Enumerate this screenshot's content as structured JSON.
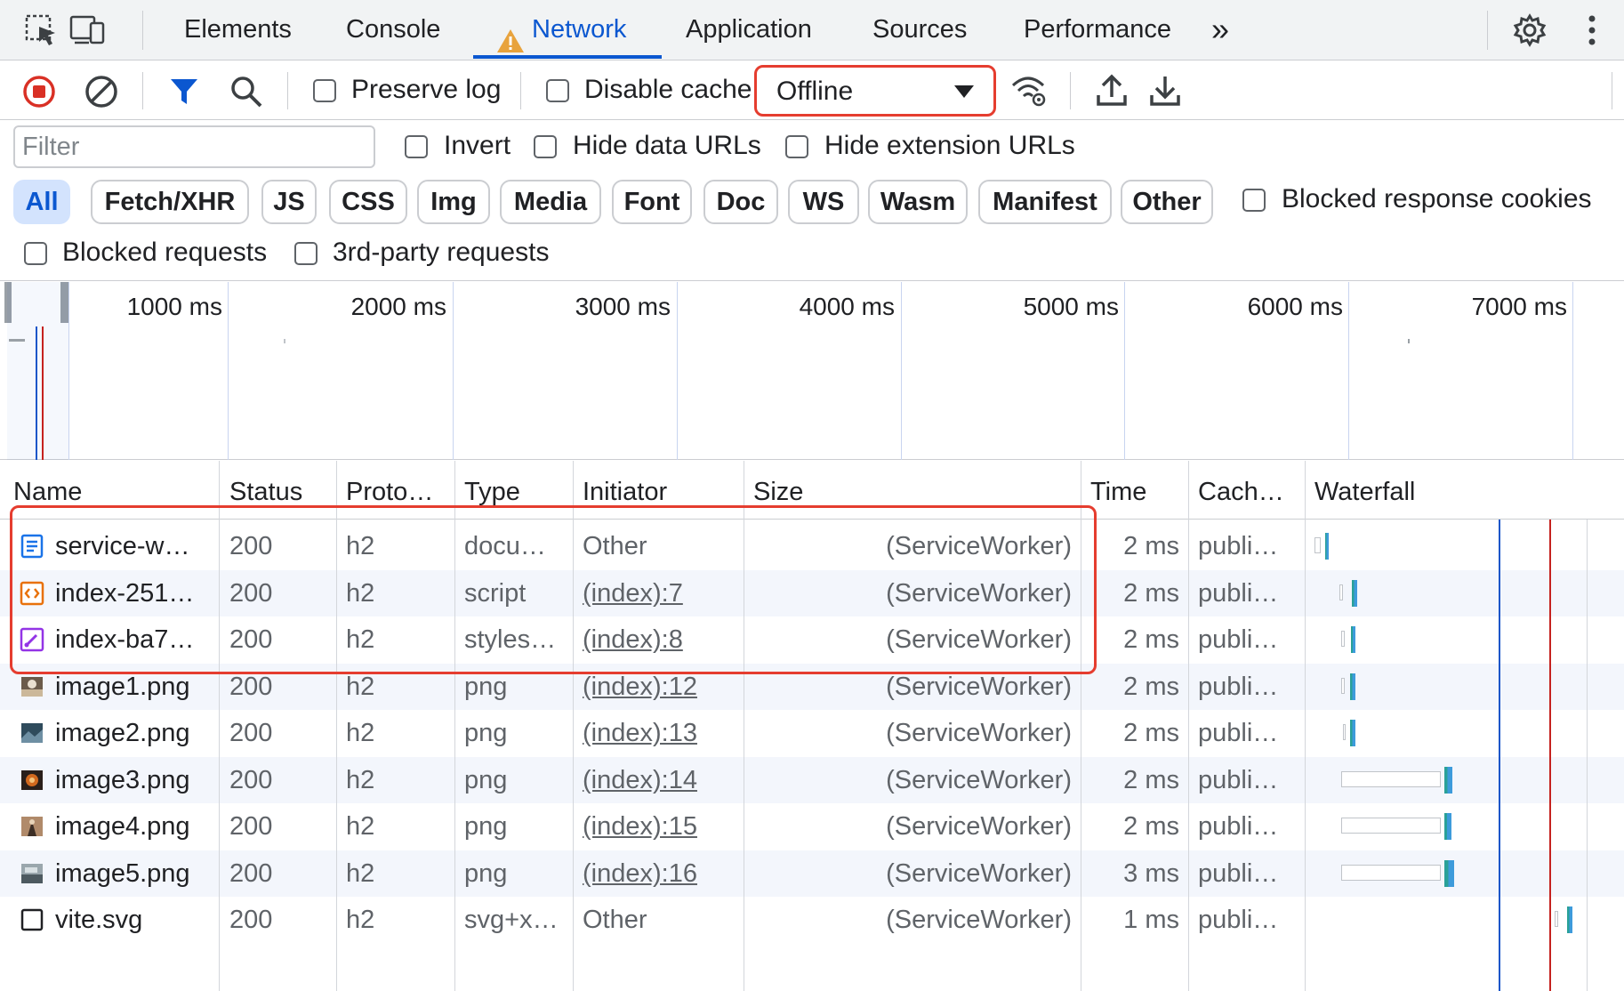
{
  "tabs": {
    "elements": "Elements",
    "console": "Console",
    "network": "Network",
    "application": "Application",
    "sources": "Sources",
    "performance": "Performance",
    "more": "»"
  },
  "toolbar": {
    "preserve_log": "Preserve log",
    "disable_cache": "Disable cache",
    "throttling_value": "Offline"
  },
  "filter": {
    "placeholder": "Filter",
    "invert": "Invert",
    "hide_data_urls": "Hide data URLs",
    "hide_extension_urls": "Hide extension URLs",
    "types": [
      "All",
      "Fetch/XHR",
      "JS",
      "CSS",
      "Img",
      "Media",
      "Font",
      "Doc",
      "WS",
      "Wasm",
      "Manifest",
      "Other"
    ],
    "active_type": "All",
    "blocked_response_cookies": "Blocked response cookies",
    "blocked_requests": "Blocked requests",
    "third_party_requests": "3rd-party requests"
  },
  "overview": {
    "ticks": [
      "1000 ms",
      "2000 ms",
      "3000 ms",
      "4000 ms",
      "5000 ms",
      "6000 ms",
      "7000 ms"
    ]
  },
  "table": {
    "headers": {
      "name": "Name",
      "status": "Status",
      "protocol": "Proto…",
      "type": "Type",
      "initiator": "Initiator",
      "size": "Size",
      "time": "Time",
      "cache": "Cach…",
      "waterfall": "Waterfall"
    },
    "rows": [
      {
        "name": "service-w…",
        "status": "200",
        "protocol": "h2",
        "type": "docu…",
        "initiator": "Other",
        "size": "(ServiceWorker)",
        "time": "2 ms",
        "cache": "publi…"
      },
      {
        "name": "index-251…",
        "status": "200",
        "protocol": "h2",
        "type": "script",
        "initiator": "(index):7",
        "size": "(ServiceWorker)",
        "time": "2 ms",
        "cache": "publi…"
      },
      {
        "name": "index-ba7…",
        "status": "200",
        "protocol": "h2",
        "type": "styles…",
        "initiator": "(index):8",
        "size": "(ServiceWorker)",
        "time": "2 ms",
        "cache": "publi…"
      },
      {
        "name": "image1.png",
        "status": "200",
        "protocol": "h2",
        "type": "png",
        "initiator": "(index):12",
        "size": "(ServiceWorker)",
        "time": "2 ms",
        "cache": "publi…"
      },
      {
        "name": "image2.png",
        "status": "200",
        "protocol": "h2",
        "type": "png",
        "initiator": "(index):13",
        "size": "(ServiceWorker)",
        "time": "2 ms",
        "cache": "publi…"
      },
      {
        "name": "image3.png",
        "status": "200",
        "protocol": "h2",
        "type": "png",
        "initiator": "(index):14",
        "size": "(ServiceWorker)",
        "time": "2 ms",
        "cache": "publi…"
      },
      {
        "name": "image4.png",
        "status": "200",
        "protocol": "h2",
        "type": "png",
        "initiator": "(index):15",
        "size": "(ServiceWorker)",
        "time": "2 ms",
        "cache": "publi…"
      },
      {
        "name": "image5.png",
        "status": "200",
        "protocol": "h2",
        "type": "png",
        "initiator": "(index):16",
        "size": "(ServiceWorker)",
        "time": "3 ms",
        "cache": "publi…"
      },
      {
        "name": "vite.svg",
        "status": "200",
        "protocol": "h2",
        "type": "svg+x…",
        "initiator": "Other",
        "size": "(ServiceWorker)",
        "time": "1 ms",
        "cache": "publi…"
      }
    ]
  },
  "colors": {
    "accent": "#0b57d0",
    "highlight": "#e53d2f",
    "record": "#d93025",
    "dom_content_loaded": "#1a56c9",
    "load": "#c5221f",
    "waterfall_bar": "#3d9bdb",
    "waterfall_receive": "#2aa198"
  }
}
